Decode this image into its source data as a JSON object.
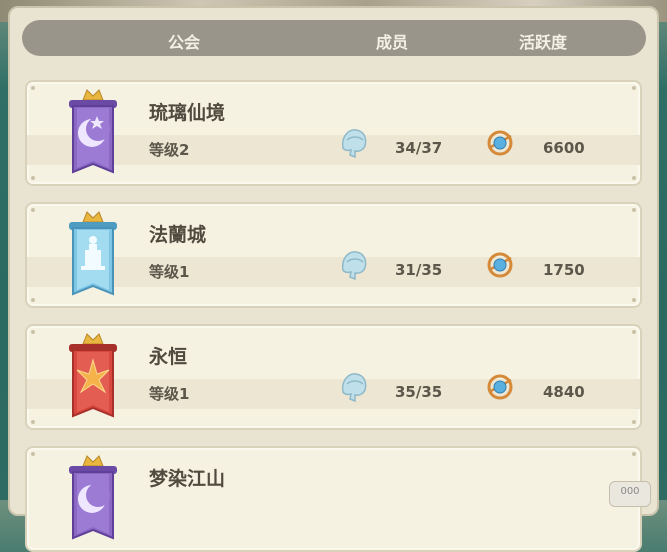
{
  "header": {
    "col_guild": "公会",
    "col_members": "成员",
    "col_activity": "活跃度"
  },
  "guilds": [
    {
      "name": "琉璃仙境",
      "level": "等级2",
      "members": "34/37",
      "activity": "6600",
      "banner_color": "#8a68c4",
      "emblem": "moon-star-emblem"
    },
    {
      "name": "法蘭城",
      "level": "等级1",
      "members": "31/35",
      "activity": "1750",
      "banner_color": "#7fc6e6",
      "emblem": "tower-emblem"
    },
    {
      "name": "永恒",
      "level": "等级1",
      "members": "35/35",
      "activity": "4840",
      "banner_color": "#d9483f",
      "emblem": "phoenix-emblem"
    },
    {
      "name": "梦染江山",
      "banner_color": "#8a68c4",
      "emblem": "moon-star-emblem"
    }
  ],
  "corner_button": {
    "label": "000"
  },
  "icons": {
    "member": "member-icon",
    "activity": "activity-icon",
    "crown": "crown-icon"
  }
}
